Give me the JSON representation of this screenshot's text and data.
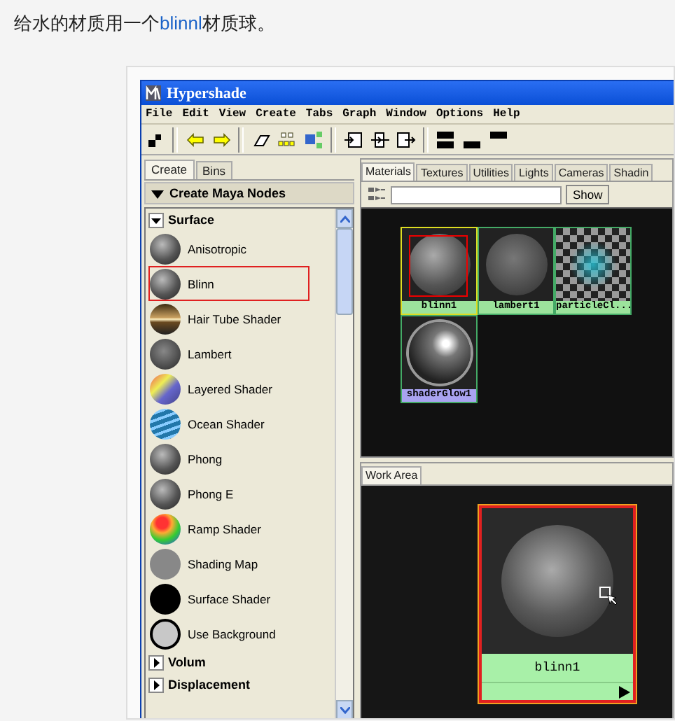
{
  "article": {
    "text_before": "给水的材质用一个",
    "highlight": "blinnl",
    "text_after": "材质球。"
  },
  "window": {
    "title": "Hypershade"
  },
  "menu": [
    "File",
    "Edit",
    "View",
    "Create",
    "Tabs",
    "Graph",
    "Window",
    "Options",
    "Help"
  ],
  "create_panel": {
    "tabs": [
      {
        "label": "Create",
        "selected": true
      },
      {
        "label": "Bins",
        "selected": false
      }
    ],
    "header": "Create Maya Nodes",
    "sections": [
      {
        "label": "Surface",
        "expanded": true,
        "items": [
          {
            "label": "Anisotropic",
            "kind": "sphere",
            "highlighted": false
          },
          {
            "label": "Blinn",
            "kind": "sphere",
            "highlighted": true
          },
          {
            "label": "Hair Tube Shader",
            "kind": "hair",
            "highlighted": false
          },
          {
            "label": "Lambert",
            "kind": "matte",
            "highlighted": false
          },
          {
            "label": "Layered Shader",
            "kind": "layered",
            "highlighted": false
          },
          {
            "label": "Ocean Shader",
            "kind": "ocean",
            "highlighted": false
          },
          {
            "label": "Phong",
            "kind": "sphere",
            "highlighted": false
          },
          {
            "label": "Phong E",
            "kind": "sphere",
            "highlighted": false
          },
          {
            "label": "Ramp Shader",
            "kind": "ramp",
            "highlighted": false
          },
          {
            "label": "Shading Map",
            "kind": "flat",
            "highlighted": false
          },
          {
            "label": "Surface Shader",
            "kind": "black",
            "highlighted": false
          },
          {
            "label": "Use Background",
            "kind": "ring",
            "highlighted": false
          }
        ]
      },
      {
        "label": "Volum",
        "expanded": false
      },
      {
        "label": "Displacement",
        "expanded": false
      }
    ]
  },
  "browser": {
    "tabs": [
      {
        "label": "Materials",
        "selected": true
      },
      {
        "label": "Textures",
        "selected": false
      },
      {
        "label": "Utilities",
        "selected": false
      },
      {
        "label": "Lights",
        "selected": false
      },
      {
        "label": "Cameras",
        "selected": false
      },
      {
        "label": "Shadin",
        "selected": false
      }
    ],
    "show_button": "Show",
    "swatches": [
      {
        "label": "blinn1",
        "kind": "sphere",
        "selected": true,
        "highlighted": true,
        "color": "#9ce39c"
      },
      {
        "label": "lambert1",
        "kind": "matte",
        "selected": false,
        "highlighted": false,
        "color": "#9ce39c"
      },
      {
        "label": "particleCl...",
        "kind": "checker",
        "selected": false,
        "highlighted": false,
        "color": "#9ce39c"
      },
      {
        "label": "shaderGlow1",
        "kind": "glow",
        "selected": false,
        "highlighted": false,
        "color": "#a9a3f0"
      }
    ]
  },
  "work_area": {
    "tab": "Work Area",
    "node": {
      "label": "blinn1",
      "selected": true
    }
  }
}
